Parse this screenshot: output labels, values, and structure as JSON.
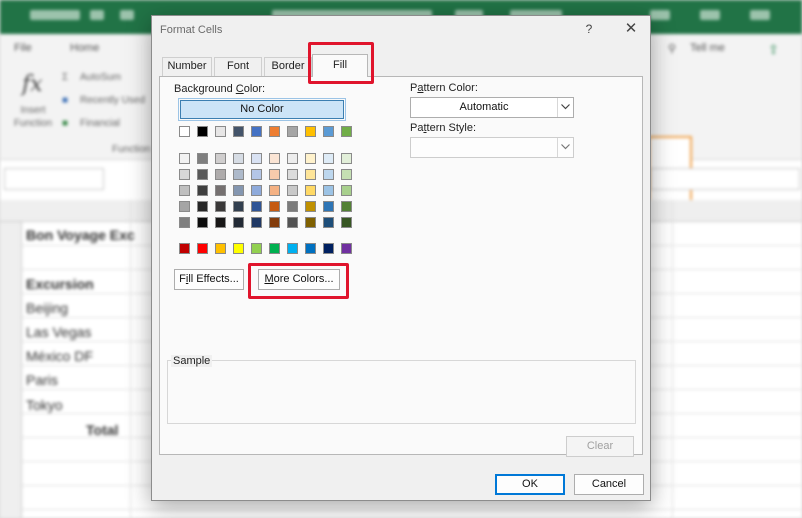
{
  "background_app": {
    "tabs": [
      "File",
      "Home",
      "Tell me"
    ],
    "ribbon": {
      "insert_function_label": "Insert Function",
      "autosum_label": "AutoSum",
      "recently_used_label": "Recently Used",
      "financial_label": "Financial",
      "group_label": "Function"
    },
    "cells": {
      "title": "Bon Voyage Exc",
      "header": "Excursion",
      "rows": [
        "Beijing",
        "Las Vegas",
        "México DF",
        "Paris",
        "Tokyo"
      ],
      "total": "Total"
    }
  },
  "dialog": {
    "title": "Format Cells",
    "help_label": "?",
    "close_label": "✕",
    "tabs": {
      "number": "Number",
      "font": "Font",
      "border": "Border",
      "fill": "Fill"
    },
    "active_tab": "Fill",
    "background_color": {
      "label_pre": "Background ",
      "label_key": "C",
      "label_post": "olor:",
      "no_color": "No Color",
      "theme_row": [
        "#ffffff",
        "#000000",
        "#e7e6e6",
        "#44546a",
        "#4472c4",
        "#ed7d31",
        "#a5a5a5",
        "#ffc000",
        "#5b9bd5",
        "#70ad47"
      ],
      "tints": [
        [
          "#f2f2f2",
          "#7f7f7f",
          "#d0cece",
          "#d6dce4",
          "#d9e2f3",
          "#fbe5d5",
          "#ededed",
          "#fff2cc",
          "#deebf6",
          "#e2efd9"
        ],
        [
          "#d8d8d8",
          "#595959",
          "#aeabab",
          "#adb9ca",
          "#b4c6e7",
          "#f7cbac",
          "#dbdbdb",
          "#fee599",
          "#bdd7ee",
          "#c5e0b3"
        ],
        [
          "#bfbfbf",
          "#3f3f3f",
          "#757070",
          "#8496b0",
          "#8eaadb",
          "#f4b183",
          "#c9c9c9",
          "#ffd965",
          "#9cc3e5",
          "#a8d08d"
        ],
        [
          "#a5a5a5",
          "#262626",
          "#3a3838",
          "#323f4f",
          "#2f5496",
          "#c55a11",
          "#7b7b7b",
          "#bf9000",
          "#2e75b5",
          "#538135"
        ],
        [
          "#7f7f7f",
          "#0c0c0c",
          "#171616",
          "#222a35",
          "#1f3864",
          "#833c0b",
          "#525252",
          "#7f6000",
          "#1e4e79",
          "#375623"
        ]
      ],
      "standard": [
        "#c00000",
        "#ff0000",
        "#ffc000",
        "#ffff00",
        "#92d050",
        "#00b050",
        "#00b0f0",
        "#0070c0",
        "#002060",
        "#7030a0"
      ]
    },
    "fill_effects_button": {
      "pre": "F",
      "key": "i",
      "post": "ll Effects..."
    },
    "more_colors_button": {
      "key": "M",
      "post": "ore Colors..."
    },
    "pattern_color": {
      "label_pre": "P",
      "label_key": "a",
      "label_post": "ttern Color:",
      "value": "Automatic"
    },
    "pattern_style": {
      "label_pre": "Pa",
      "label_key": "t",
      "label_post": "tern Style:",
      "value": ""
    },
    "sample_label": "Sample",
    "clear_button": "Clear",
    "ok_button": "OK",
    "cancel_button": "Cancel"
  },
  "colors": {
    "annotation_highlight": "#e0142c",
    "selected_fill": "#cce4f7",
    "excel_green": "#217346"
  }
}
